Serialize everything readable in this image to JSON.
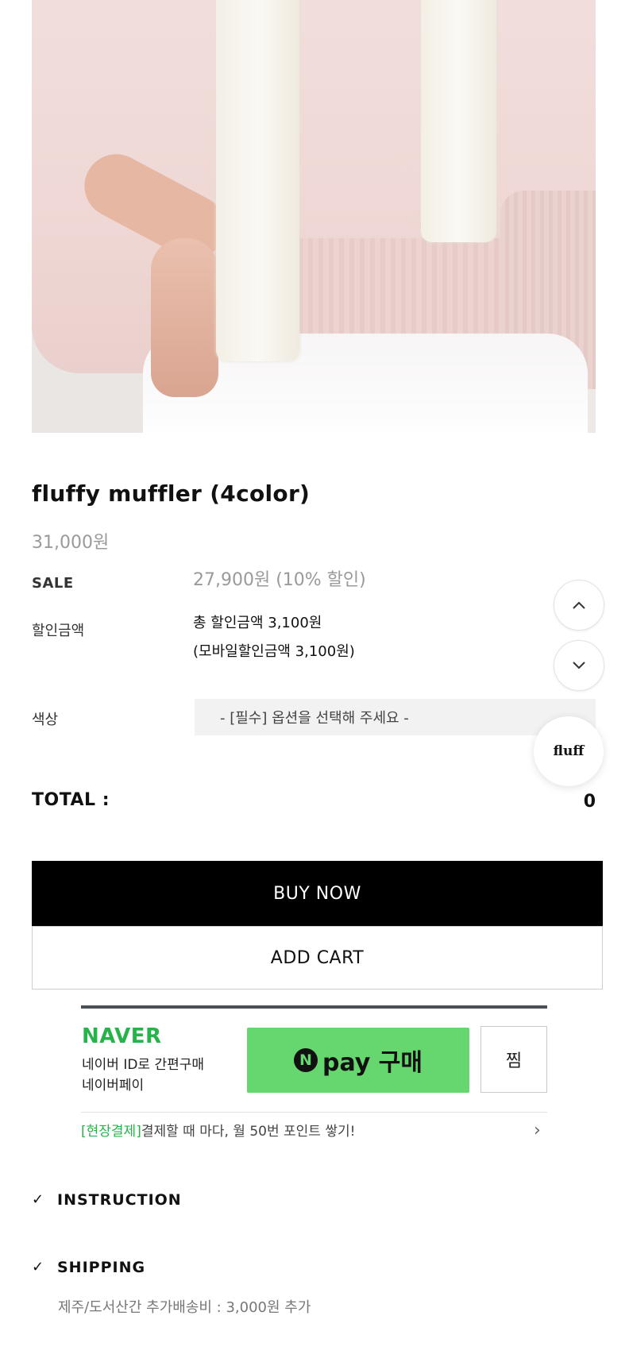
{
  "product": {
    "title": "fluffy muffler (4color)",
    "original_price": "31,000원",
    "sale_label": "SALE",
    "sale_price": "27,900원 (10% 할인)",
    "discount_label": "할인금액",
    "discount_total": "총 할인금액 3,100원",
    "discount_mobile": "(모바일할인금액 3,100원)",
    "color_label": "색상",
    "option_placeholder": "- [필수] 옵션을 선택해 주세요 -"
  },
  "total": {
    "label": "TOTAL :",
    "value": "0"
  },
  "actions": {
    "buy_now": "BUY NOW",
    "add_cart": "ADD CART"
  },
  "naver": {
    "brand": "NAVER",
    "sub_line1": "네이버 ID로 간편구매",
    "sub_line2": "네이버페이",
    "pay_logo_letter": "N",
    "pay_label": "pay 구매",
    "wish_label": "찜",
    "promo_highlight": "[현장결제]",
    "promo_text": "결제할 때 마다, 월 50번 포인트 쌓기!"
  },
  "accordion": [
    {
      "title": "INSTRUCTION"
    },
    {
      "title": "SHIPPING",
      "note": "제주/도서산간 추가배송비 : 3,000원 추가"
    }
  ],
  "floating": {
    "chat_label": "fluff"
  },
  "colors": {
    "naver_green": "#27b34a",
    "npay_button": "#66d66f",
    "buy_now_bg": "#000000"
  },
  "icons": {
    "check": "checkmark-icon",
    "scroll_up": "chevron-up-icon",
    "scroll_down": "chevron-down-icon",
    "promo_arrow": "chevron-right-icon"
  }
}
